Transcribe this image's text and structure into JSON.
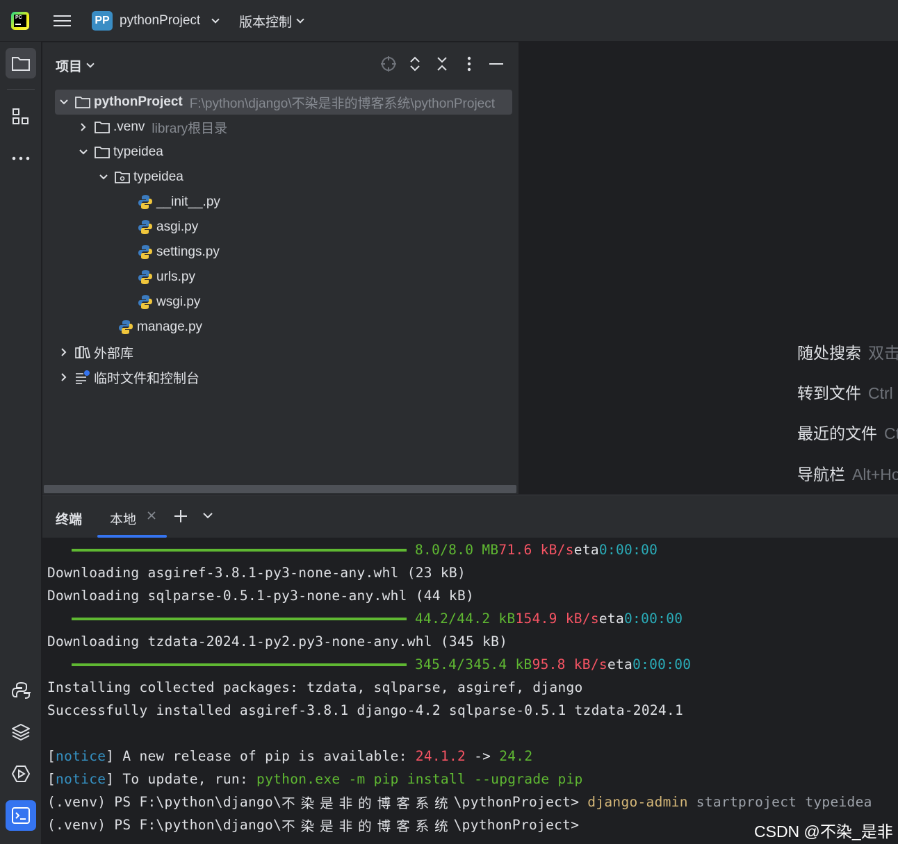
{
  "titlebar": {
    "project_badge": "PP",
    "project_name": "pythonProject",
    "vcs_label": "版本控制"
  },
  "project_panel": {
    "title": "项目",
    "tree": [
      {
        "label": "pythonProject",
        "hint": "F:\\python\\django\\不染是非的博客系统\\pythonProject"
      },
      {
        "label": ".venv",
        "hint": "library根目录"
      },
      {
        "label": "typeidea"
      },
      {
        "label": "typeidea"
      },
      {
        "label": "__init__.py"
      },
      {
        "label": "asgi.py"
      },
      {
        "label": "settings.py"
      },
      {
        "label": "urls.py"
      },
      {
        "label": "wsgi.py"
      },
      {
        "label": "manage.py"
      },
      {
        "label": "外部库"
      },
      {
        "label": "临时文件和控制台"
      }
    ]
  },
  "editor_hints": [
    {
      "name": "随处搜索",
      "key": "双击"
    },
    {
      "name": "转到文件",
      "key": "Ctrl"
    },
    {
      "name": "最近的文件",
      "key": "Ctrl"
    },
    {
      "name": "导航栏",
      "key": "Alt+Home"
    }
  ],
  "terminal": {
    "title": "终端",
    "tab_local": "本地",
    "lines": {
      "l1_size": "8.0/8.0 MB",
      "l1_speed": "71.6 kB/s",
      "l1_eta": "eta",
      "l1_time": "0:00:00",
      "l2": "Downloading asgiref-3.8.1-py3-none-any.whl (23 kB)",
      "l3": "Downloading sqlparse-0.5.1-py3-none-any.whl (44 kB)",
      "l4_size": "44.2/44.2 kB",
      "l4_speed": "154.9 kB/s",
      "l4_eta": "eta",
      "l4_time": "0:00:00",
      "l5": "Downloading tzdata-2024.1-py2.py3-none-any.whl (345 kB)",
      "l6_size": "345.4/345.4 kB",
      "l6_speed": "95.8 kB/s",
      "l6_eta": "eta",
      "l6_time": "0:00:00",
      "l7": "Installing collected packages: tzdata, sqlparse, asgiref, django",
      "l8": "Successfully installed asgiref-3.8.1 django-4.2 sqlparse-0.5.1 tzdata-2024.1",
      "l9_notice": "notice",
      "l9_text": " A new release of pip is available: ",
      "l9_old": "24.1.2",
      "l9_arrow": " -> ",
      "l9_new": "24.2",
      "l10_notice": "notice",
      "l10_text": " To update, run: ",
      "l10_cmd": "python.exe -m pip install --upgrade pip",
      "l11_prompt_a": "(.venv) PS F:\\python\\django\\",
      "l11_prompt_cjk": "不染是非的博客系统",
      "l11_prompt_b": "\\pythonProject> ",
      "l11_cmd": "django-admin",
      "l11_args": " startproject typeidea",
      "l12_prompt_a": "(.venv) PS F:\\python\\django\\",
      "l12_prompt_cjk": "不染是非的博客系统",
      "l12_prompt_b": "\\pythonProject>"
    }
  },
  "watermark": "CSDN @不染_是非",
  "colors": {
    "accent": "#3574f0",
    "progress_green": "#5fb832",
    "speed_red": "#f75464",
    "eta_cyan": "#2aacb8",
    "notice_blue": "#3592c4",
    "command_yellow": "#d5b778"
  }
}
